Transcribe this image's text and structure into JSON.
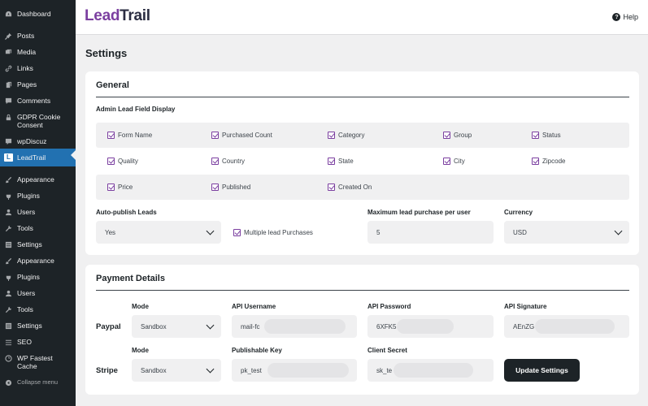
{
  "sidebar": {
    "items": [
      {
        "label": "Dashboard",
        "icon": "dashboard-icon"
      },
      {
        "label": "Posts",
        "icon": "pin-icon"
      },
      {
        "label": "Media",
        "icon": "media-icon"
      },
      {
        "label": "Links",
        "icon": "link-icon"
      },
      {
        "label": "Pages",
        "icon": "pages-icon"
      },
      {
        "label": "Comments",
        "icon": "comment-icon"
      },
      {
        "label": "GDPR Cookie Consent",
        "icon": "lock-icon"
      },
      {
        "label": "wpDiscuz",
        "icon": "chat-icon"
      },
      {
        "label": "LeadTrail",
        "icon": "leadtrail-icon"
      },
      {
        "label": "Appearance",
        "icon": "brush-icon"
      },
      {
        "label": "Plugins",
        "icon": "plugin-icon"
      },
      {
        "label": "Users",
        "icon": "user-icon"
      },
      {
        "label": "Tools",
        "icon": "wrench-icon"
      },
      {
        "label": "Settings",
        "icon": "settings-icon"
      },
      {
        "label": "Appearance",
        "icon": "brush-icon"
      },
      {
        "label": "Plugins",
        "icon": "plugin-icon"
      },
      {
        "label": "Users",
        "icon": "user-icon"
      },
      {
        "label": "Tools",
        "icon": "wrench-icon"
      },
      {
        "label": "Settings",
        "icon": "settings-icon"
      },
      {
        "label": "SEO",
        "icon": "seo-icon"
      },
      {
        "label": "WP Fastest Cache",
        "icon": "cache-icon"
      },
      {
        "label": "Collapse menu",
        "icon": "collapse-icon"
      }
    ]
  },
  "header": {
    "logo_lead": "Lead",
    "logo_trail": "Trail",
    "help_label": "Help"
  },
  "page_title": "Settings",
  "general": {
    "title": "General",
    "field_display_label": "Admin Lead Field Display",
    "rows": [
      [
        "Form Name",
        "Purchased Count",
        "Category",
        "Group",
        "Status"
      ],
      [
        "Quality",
        "Country",
        "State",
        "City",
        "Zipcode"
      ],
      [
        "Price",
        "Published",
        "Created On"
      ]
    ],
    "auto_publish_label": "Auto-publish Leads",
    "auto_publish_value": "Yes",
    "multiple_purchases_label": "Multiple lead Purchases",
    "max_purchase_label": "Maximum lead purchase per user",
    "max_purchase_value": "5",
    "currency_label": "Currency",
    "currency_value": "USD"
  },
  "payment": {
    "title": "Payment Details",
    "paypal": {
      "row_label": "Paypal",
      "mode_label": "Mode",
      "mode_value": "Sandbox",
      "username_label": "API Username",
      "username_value": "mail-fc",
      "password_label": "API Password",
      "password_value": "6XFK5",
      "signature_label": "API Signature",
      "signature_value": "AEnZG"
    },
    "stripe": {
      "row_label": "Stripe",
      "mode_label": "Mode",
      "mode_value": "Sandbox",
      "publishable_label": "Publishable Key",
      "publishable_value": "pk_test",
      "secret_label": "Client Secret",
      "secret_value": "sk_te"
    },
    "update_button": "Update Settings"
  },
  "colors": {
    "brand_purple": "#7b3fa0",
    "sidebar_bg": "#1d2327",
    "active_blue": "#2271b1"
  }
}
